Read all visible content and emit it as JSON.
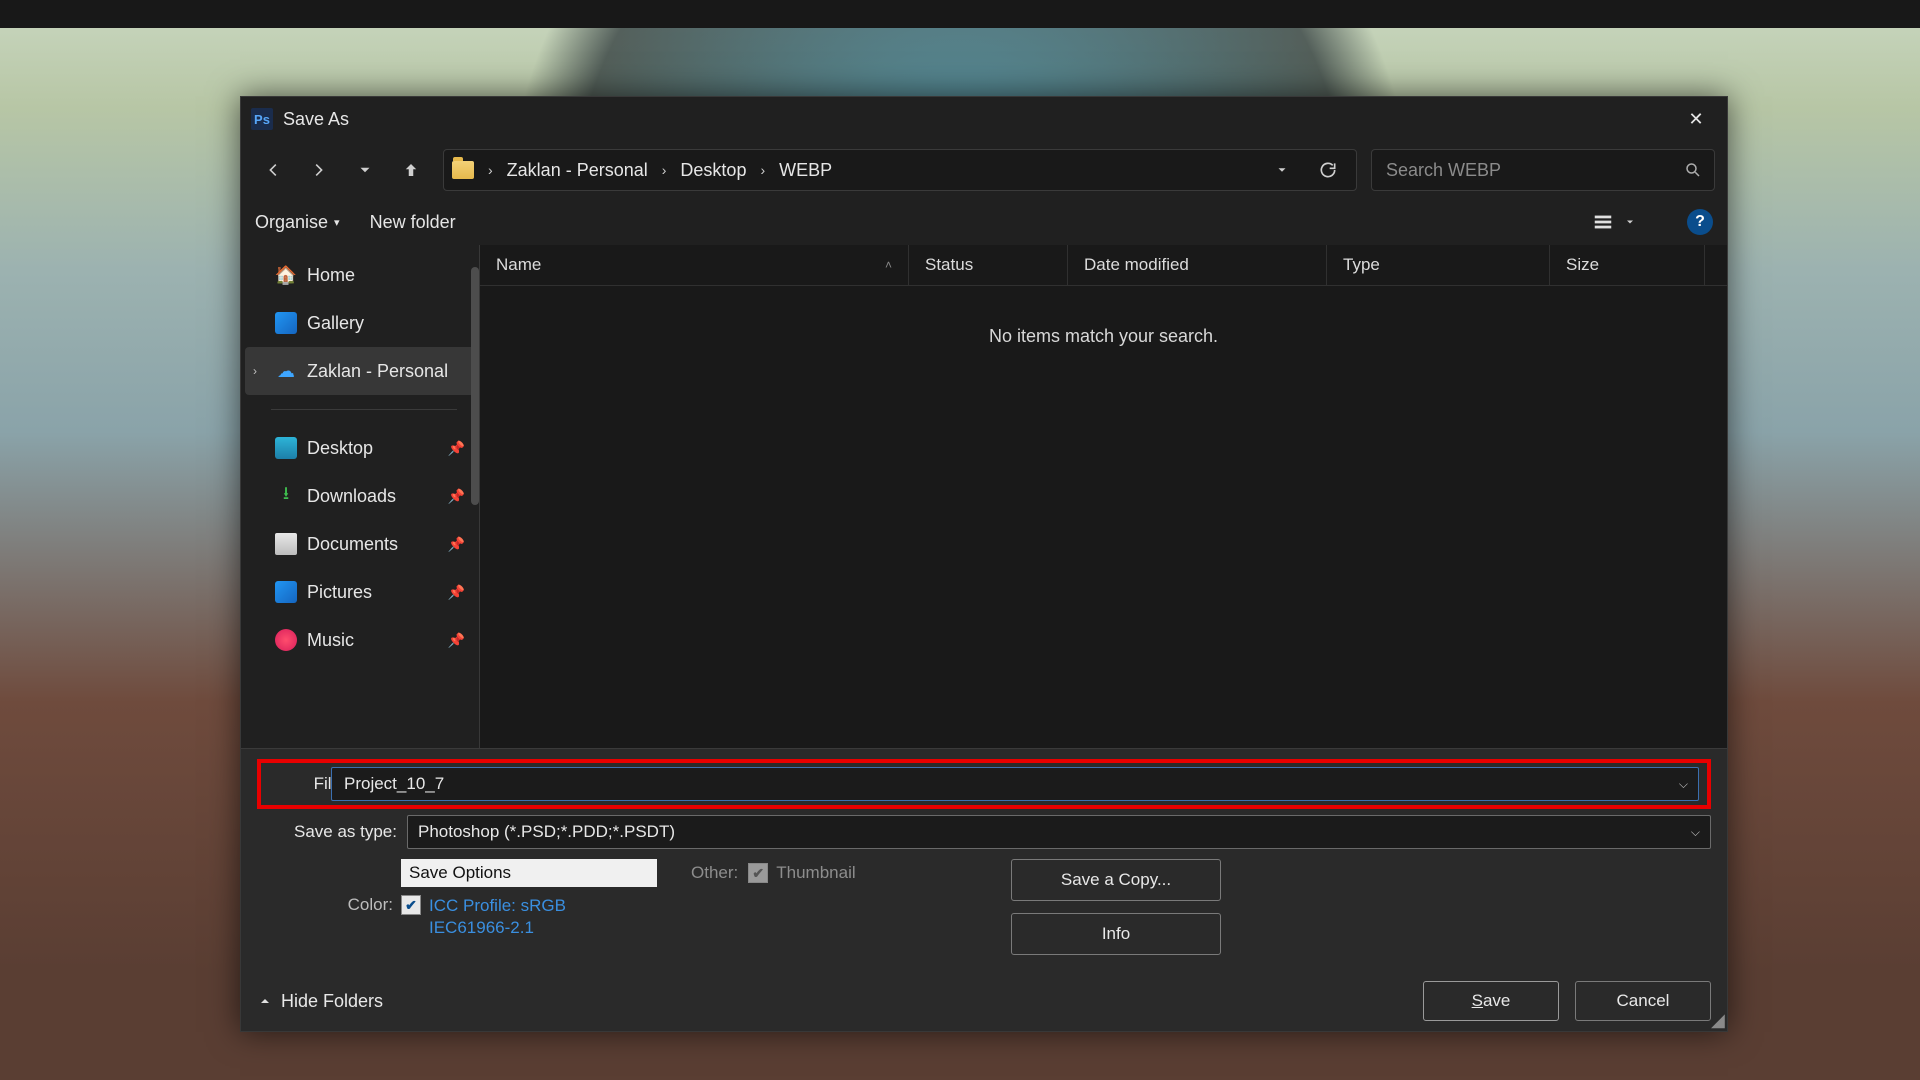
{
  "dialog": {
    "title": "Save As",
    "close_glyph": "✕"
  },
  "nav": {
    "back_tip": "Back",
    "forward_tip": "Forward",
    "recent_tip": "Recent",
    "up_tip": "Up",
    "refresh_tip": "Refresh"
  },
  "breadcrumbs": [
    "Zaklan - Personal",
    "Desktop",
    "WEBP"
  ],
  "search": {
    "placeholder": "Search WEBP"
  },
  "toolbar": {
    "organise": "Organise",
    "new_folder": "New folder"
  },
  "sidebar": {
    "home": "Home",
    "gallery": "Gallery",
    "onedrive": "Zaklan - Personal",
    "desktop": "Desktop",
    "downloads": "Downloads",
    "documents": "Documents",
    "pictures": "Pictures",
    "music": "Music"
  },
  "columns": {
    "name": "Name",
    "status": "Status",
    "date": "Date modified",
    "type": "Type",
    "size": "Size"
  },
  "list": {
    "empty": "No items match your search."
  },
  "form": {
    "filename_label": "File name:",
    "filename_value": "Project_10_7",
    "saveas_label": "Save as type:",
    "saveas_value": "Photoshop (*.PSD;*.PDD;*.PSDT)",
    "options_header": "Save Options",
    "color_label": "Color:",
    "icc_line1": "ICC Profile:  sRGB",
    "icc_line2": "IEC61966-2.1",
    "other_label": "Other:",
    "thumbnail_label": "Thumbnail",
    "save_copy": "Save a Copy...",
    "info": "Info",
    "hide_folders": "Hide Folders",
    "save": "Save",
    "cancel": "Cancel"
  }
}
